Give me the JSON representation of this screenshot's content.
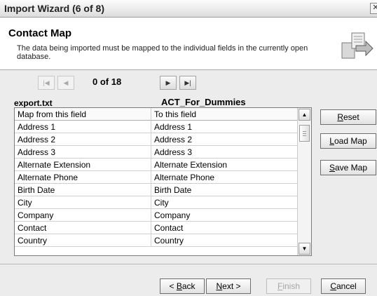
{
  "window": {
    "title": "Import Wizard (6 of 8)",
    "close_icon": "close-icon"
  },
  "header": {
    "title": "Contact Map",
    "description": "The data being imported must be mapped to the individual fields in the currently open database.",
    "icon": "map-arrow-icon"
  },
  "navigator": {
    "counter": "0 of 18",
    "first_icon": "first-record-icon",
    "prev_icon": "previous-record-icon",
    "next_icon": "next-record-icon",
    "last_icon": "last-record-icon"
  },
  "source_name": "export.txt",
  "destination_name": "ACT_For_Dummies",
  "grid": {
    "headers": [
      "Map from this field",
      "To this field"
    ],
    "rows": [
      [
        "Address 1",
        "Address 1"
      ],
      [
        "Address 2",
        "Address 2"
      ],
      [
        "Address 3",
        "Address 3"
      ],
      [
        "Alternate Extension",
        "Alternate Extension"
      ],
      [
        "Alternate Phone",
        "Alternate Phone"
      ],
      [
        "Birth Date",
        "Birth Date"
      ],
      [
        "City",
        "City"
      ],
      [
        "Company",
        "Company"
      ],
      [
        "Contact",
        "Contact"
      ],
      [
        "Country",
        "Country"
      ]
    ]
  },
  "side_buttons": {
    "reset": {
      "key": "R",
      "rest": "eset"
    },
    "load": {
      "key": "L",
      "rest": "oad Map"
    },
    "save": {
      "key": "S",
      "rest": "ave Map"
    }
  },
  "footer": {
    "back": {
      "pre": "< ",
      "key": "B",
      "rest": "ack"
    },
    "next": {
      "key": "N",
      "rest": "ext >"
    },
    "finish": {
      "key": "F",
      "rest": "inish"
    },
    "cancel": {
      "key": "C",
      "rest": "ancel"
    }
  }
}
